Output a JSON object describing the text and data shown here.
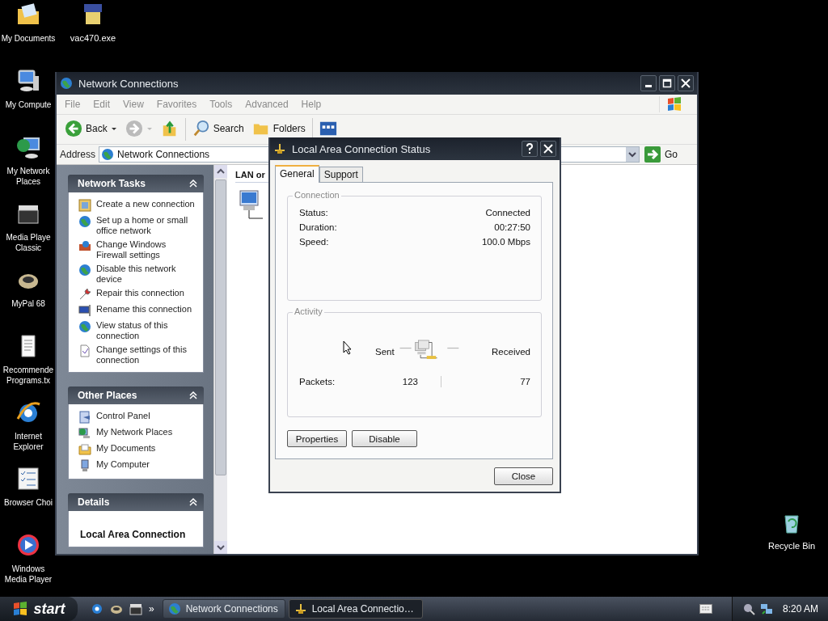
{
  "desktop_icons": [
    {
      "label": "My Documents"
    },
    {
      "label": "My Compute"
    },
    {
      "label": "My Network Places"
    },
    {
      "label": "Media Playe Classic"
    },
    {
      "label": "MyPal 68"
    },
    {
      "label": "Recommende Programs.tx"
    },
    {
      "label": "Internet Explorer"
    },
    {
      "label": "Browser Choi"
    },
    {
      "label": "Windows Media Player"
    }
  ],
  "desktop_icon_second_column": {
    "label": "vac470.exe"
  },
  "recycle_bin": {
    "label": "Recycle Bin"
  },
  "explorer": {
    "title": "Network Connections",
    "menu": [
      {
        "label": "File",
        "disabled": true
      },
      {
        "label": "Edit",
        "disabled": true
      },
      {
        "label": "View",
        "disabled": true
      },
      {
        "label": "Favorites",
        "disabled": true
      },
      {
        "label": "Tools",
        "disabled": true
      },
      {
        "label": "Advanced",
        "disabled": true
      },
      {
        "label": "Help",
        "disabled": true
      }
    ],
    "toolbar": [
      {
        "kind": "back",
        "label": "Back"
      },
      {
        "kind": "forward"
      },
      {
        "kind": "up"
      },
      {
        "kind": "search",
        "label": "Search"
      },
      {
        "kind": "folders",
        "label": "Folders"
      },
      {
        "kind": "views"
      }
    ],
    "address": {
      "label": "Address",
      "value": "Network Connections",
      "go": "Go"
    },
    "panels": [
      {
        "title": "Network Tasks",
        "items": [
          "Create a new connection",
          "Set up a home or small office network",
          "Change Windows Firewall settings",
          "Disable this network device",
          "Repair this connection",
          "Rename this connection",
          "View status of this connection",
          "Change settings of this connection"
        ]
      },
      {
        "title": "Other Places",
        "items": [
          "Control Panel",
          "My Network Places",
          "My Documents",
          "My Computer"
        ]
      },
      {
        "title": "Details",
        "heading": "Local Area Connection"
      }
    ],
    "content_header": "LAN or"
  },
  "dialog": {
    "title": "Local Area Connection Status",
    "tabs": [
      {
        "label": "General",
        "selected": true
      },
      {
        "label": "Support",
        "selected": false
      }
    ],
    "connection": {
      "legend": "Connection",
      "rows": [
        {
          "label": "Status:",
          "value": "Connected"
        },
        {
          "label": "Duration:",
          "value": "00:27:50"
        },
        {
          "label": "Speed:",
          "value": "100.0 Mbps"
        }
      ]
    },
    "activity": {
      "legend": "Activity",
      "sent": "Sent",
      "received": "Received",
      "packets_label": "Packets:",
      "packets_sent": "123",
      "packets_received": "77"
    },
    "buttons": [
      "Properties",
      "Disable"
    ],
    "close": "Close"
  },
  "taskbar": {
    "start": "start",
    "more": "»",
    "tasks": [
      {
        "label": "Network Connections",
        "selected": false
      },
      {
        "label": "Local Area Connectio…",
        "selected": true
      }
    ],
    "clock": "8:20 AM"
  }
}
